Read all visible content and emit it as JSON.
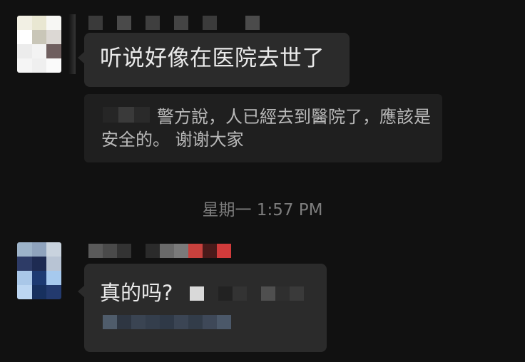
{
  "messages": [
    {
      "text": "听说好像在医院去世了"
    },
    {
      "text": "真的吗?"
    }
  ],
  "quote": {
    "text": "警方說，人已經去到醫院了，應該是安全的。 谢谢大家"
  },
  "timestamp": "星期一 1:57 PM",
  "colors": {
    "background": "#111111",
    "bubble": "#2b2b2b",
    "quote_card": "#1f1f1f",
    "text": "#eaeaea",
    "muted_text": "#7d7d7d"
  }
}
